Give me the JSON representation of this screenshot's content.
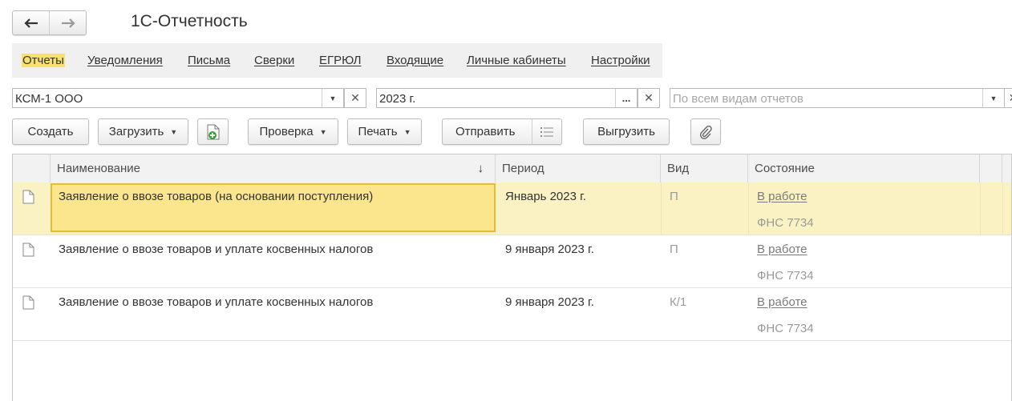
{
  "app": {
    "title": "1С-Отчетность"
  },
  "nav": {
    "back_icon": "arrow-left-icon",
    "forward_icon": "arrow-right-icon"
  },
  "tabs": [
    {
      "label": "Отчеты",
      "active": true
    },
    {
      "label": "Уведомления"
    },
    {
      "label": "Письма"
    },
    {
      "label": "Сверки"
    },
    {
      "label": "ЕГРЮЛ"
    },
    {
      "label": "Входящие"
    },
    {
      "label": "Личные кабинеты"
    },
    {
      "label": "Настройки"
    }
  ],
  "filters": {
    "organization": "КСМ-1 ООО",
    "period": "2023 г.",
    "period_select": "...",
    "report_types_placeholder": "По всем видам отчетов"
  },
  "toolbar": {
    "create": "Создать",
    "upload": "Загрузить",
    "check": "Проверка",
    "print": "Печать",
    "send": "Отправить",
    "export": "Выгрузить"
  },
  "table": {
    "columns": {
      "name": "Наименование",
      "period": "Период",
      "kind": "Вид",
      "state": "Состояние"
    },
    "sort_indicator": "↓",
    "rows": [
      {
        "name": "Заявление о ввозе товаров (на основании поступления)",
        "period": "Январь 2023 г.",
        "kind": "П",
        "state": "В работе",
        "org": "ФНС 7734",
        "selected": true
      },
      {
        "name": "Заявление о ввозе товаров и уплате косвенных налогов",
        "period": "9 января 2023 г.",
        "kind": "П",
        "state": "В работе",
        "org": "ФНС 7734"
      },
      {
        "name": "Заявление о ввозе товаров и уплате косвенных налогов",
        "period": "9 января 2023 г.",
        "kind": "К/1",
        "state": "В работе",
        "org": "ФНС 7734"
      }
    ]
  },
  "colors": {
    "accent_yellow": "#f7e06b",
    "selection": "#fbe58d",
    "selection_border": "#e8bb35"
  }
}
